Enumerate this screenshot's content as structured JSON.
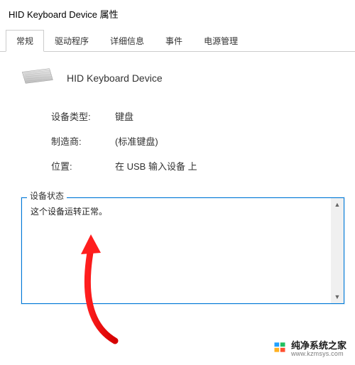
{
  "window": {
    "title": "HID Keyboard Device 属性"
  },
  "tabs": [
    {
      "label": "常规",
      "active": true
    },
    {
      "label": "驱动程序",
      "active": false
    },
    {
      "label": "详细信息",
      "active": false
    },
    {
      "label": "事件",
      "active": false
    },
    {
      "label": "电源管理",
      "active": false
    }
  ],
  "device": {
    "name": "HID Keyboard Device"
  },
  "info": [
    {
      "label": "设备类型:",
      "value": "键盘"
    },
    {
      "label": "制造商:",
      "value": "(标准键盘)"
    },
    {
      "label": "位置:",
      "value": "在 USB 输入设备 上"
    }
  ],
  "status": {
    "label": "设备状态",
    "text": "这个设备运转正常。"
  },
  "watermark": {
    "cn": "纯净系统之家",
    "url": "www.kzmsys.com"
  }
}
